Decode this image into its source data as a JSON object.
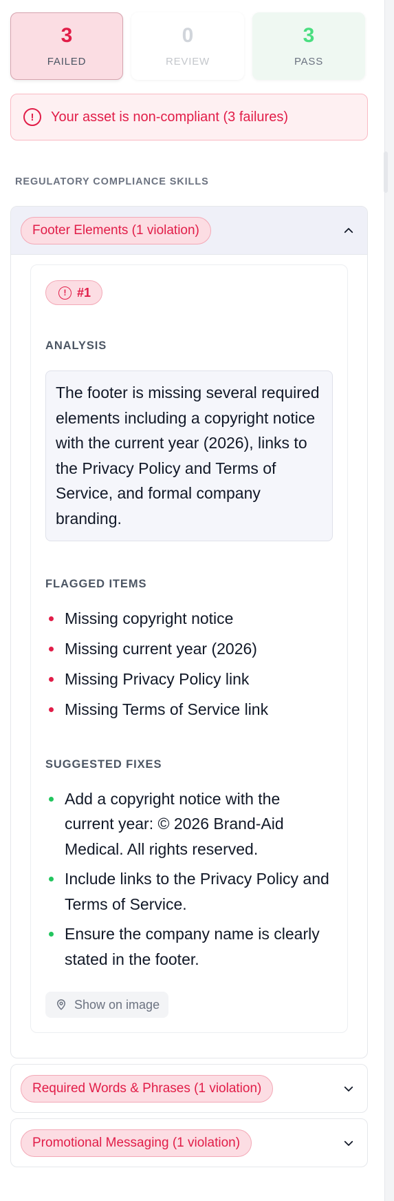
{
  "summary": {
    "failed": {
      "count": "3",
      "label": "FAILED"
    },
    "review": {
      "count": "0",
      "label": "REVIEW"
    },
    "pass": {
      "count": "3",
      "label": "PASS"
    }
  },
  "alert": {
    "icon": "alert-circle-icon",
    "text": "Your asset is non-compliant (3 failures)"
  },
  "section_heading": "REGULATORY COMPLIANCE SKILLS",
  "skills": [
    {
      "label": "Footer Elements (1 violation)",
      "expanded": true,
      "violation": {
        "number": "#1",
        "analysis_heading": "ANALYSIS",
        "analysis": "The footer is missing several required elements including a copyright notice with the current year (2026), links to the Privacy Policy and Terms of Service, and formal company branding.",
        "flagged_heading": "FLAGGED ITEMS",
        "flagged": [
          "Missing copyright notice",
          "Missing current year (2026)",
          "Missing Privacy Policy link",
          "Missing Terms of Service link"
        ],
        "fixes_heading": "SUGGESTED FIXES",
        "fixes": [
          "Add a copyright notice with the current year: © 2026 Brand-Aid Medical. All rights reserved.",
          "Include links to the Privacy Policy and Terms of Service.",
          "Ensure the company name is clearly stated in the footer."
        ],
        "show_on_image": "Show on image"
      }
    },
    {
      "label": "Required Words & Phrases (1 violation)",
      "expanded": false
    },
    {
      "label": "Promotional Messaging (1 violation)",
      "expanded": false
    }
  ],
  "colors": {
    "fail": "#e11d48",
    "pass": "#4ade80",
    "bullet_fix": "#22c55e"
  }
}
